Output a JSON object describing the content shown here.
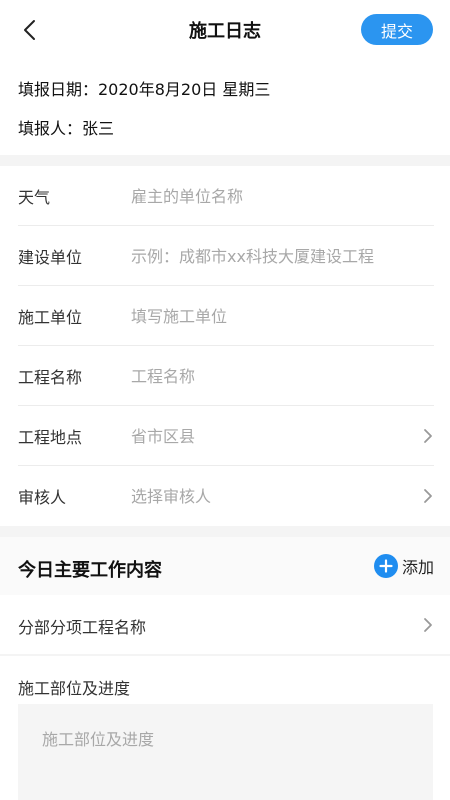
{
  "nav": {
    "title": "施工日志",
    "submit_label": "提交"
  },
  "meta": {
    "date_line": "填报日期：2020年8月20日 星期三",
    "reporter_line": "填报人：张三"
  },
  "form": {
    "weather": {
      "label": "天气",
      "placeholder": "雇主的单位名称"
    },
    "construction_unit": {
      "label": "建设单位",
      "placeholder": "示例：成都市xx科技大厦建设工程"
    },
    "builder_unit": {
      "label": "施工单位",
      "placeholder": "填写施工单位"
    },
    "project_name": {
      "label": "工程名称",
      "placeholder": "工程名称"
    },
    "project_location": {
      "label": "工程地点",
      "placeholder": "省市区县"
    },
    "reviewer": {
      "label": "审核人",
      "placeholder": "选择审核人"
    }
  },
  "work": {
    "section_title": "今日主要工作内容",
    "add_label": "添加",
    "sub_project_label": "分部分项工程名称",
    "progress_label": "施工部位及进度",
    "progress_placeholder": "施工部位及进度"
  },
  "colors": {
    "accent": "#2b95f0",
    "add_icon": "#1f8df0",
    "placeholder": "#a8a8a8",
    "divider": "#ececec"
  },
  "icons": {
    "back": "chevron-left-icon",
    "chevron": "chevron-right-icon",
    "add": "plus-circle-icon"
  }
}
